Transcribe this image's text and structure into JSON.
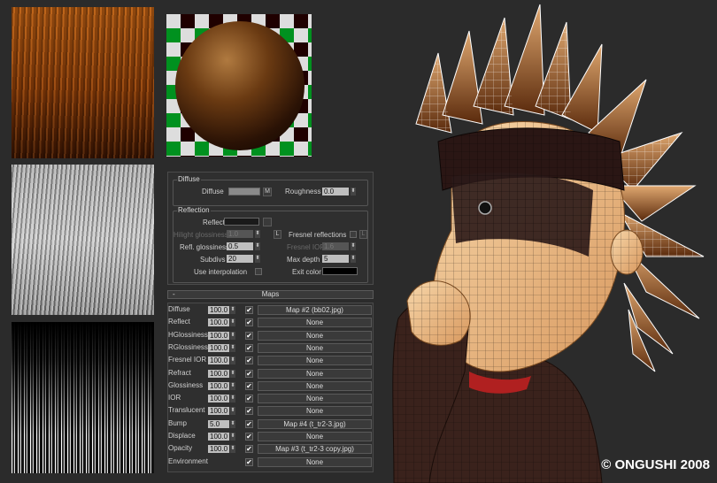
{
  "diffuse": {
    "group_title": "Diffuse",
    "diffuse_label": "Diffuse",
    "diffuse_color": "#8a8a8a",
    "map_button": "M",
    "roughness_label": "Roughness",
    "roughness_value": "0.0"
  },
  "reflection": {
    "group_title": "Reflection",
    "reflect_label": "Reflect",
    "reflect_color": "#1a1a1a",
    "hilight_label": "Hilight glossiness",
    "hilight_value": "1.0",
    "lock_label": "L",
    "fresnel_label": "Fresnel reflections",
    "fresnel_lock": "L",
    "refl_gloss_label": "Refl. glossiness",
    "refl_gloss_value": "0.5",
    "fresnel_ior_label": "Fresnel IOR",
    "fresnel_ior_value": "1.6",
    "subdivs_label": "Subdivs",
    "subdivs_value": "20",
    "max_depth_label": "Max depth",
    "max_depth_value": "5",
    "use_interp_label": "Use interpolation",
    "exit_color_label": "Exit color",
    "exit_color": "#000000"
  },
  "maps": {
    "collapse": "-",
    "title": "Maps",
    "rows": [
      {
        "name": "Diffuse",
        "amount": "100.0",
        "checked": true,
        "map": "Map #2 (bb02.jpg)"
      },
      {
        "name": "Reflect",
        "amount": "100.0",
        "checked": true,
        "map": "None"
      },
      {
        "name": "HGlossiness",
        "amount": "100.0",
        "checked": true,
        "map": "None"
      },
      {
        "name": "RGlossiness",
        "amount": "100.0",
        "checked": true,
        "map": "None"
      },
      {
        "name": "Fresnel IOR",
        "amount": "100.0",
        "checked": true,
        "map": "None"
      },
      {
        "name": "Refract",
        "amount": "100.0",
        "checked": true,
        "map": "None"
      },
      {
        "name": "Glossiness",
        "amount": "100.0",
        "checked": true,
        "map": "None"
      },
      {
        "name": "IOR",
        "amount": "100.0",
        "checked": true,
        "map": "None"
      },
      {
        "name": "Translucent",
        "amount": "100.0",
        "checked": true,
        "map": "None"
      },
      {
        "name": "Bump",
        "amount": "5.0",
        "checked": true,
        "map": "Map #4 (t_tr2-3.jpg)"
      },
      {
        "name": "Displace",
        "amount": "100.0",
        "checked": true,
        "map": "None"
      },
      {
        "name": "Opacity",
        "amount": "100.0",
        "checked": true,
        "map": "Map #3 (t_tr2-3 copy.jpg)"
      },
      {
        "name": "Environment",
        "amount": "",
        "checked": true,
        "map": "None"
      }
    ]
  },
  "credit": "© ONGUSHI 2008"
}
